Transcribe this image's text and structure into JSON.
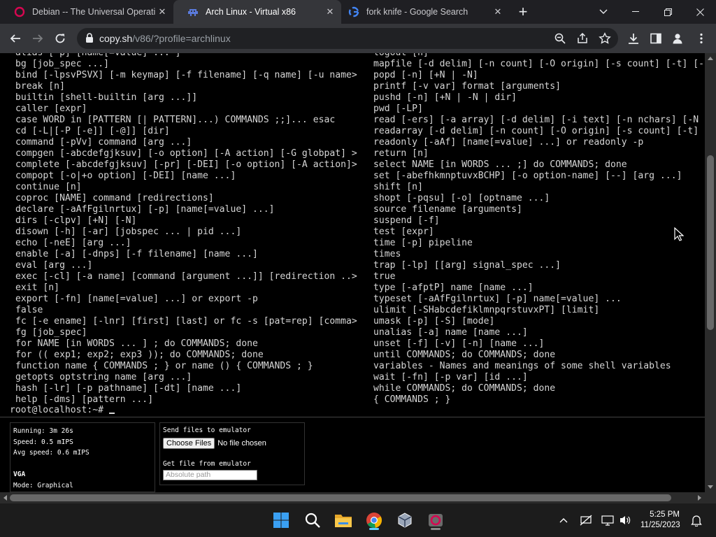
{
  "tabs": [
    {
      "title": "Debian -- The Universal Operati",
      "favicon": "debian-swirl-icon",
      "active": false
    },
    {
      "title": "Arch Linux - Virtual x86",
      "favicon": "space-invader-icon",
      "active": true
    },
    {
      "title": "fork knife - Google Search",
      "favicon": "google-g-icon",
      "active": false
    }
  ],
  "toolbar": {
    "url_host": "copy.sh",
    "url_path": "/v86/?profile=archlinux"
  },
  "terminal": {
    "left_column": [
      "alias [-p] [name[=value] ... ]",
      "bg [job_spec ...]",
      "bind [-lpsvPSVX] [-m keymap] [-f filename] [-q name] [-u name>",
      "break [n]",
      "builtin [shell-builtin [arg ...]]",
      "caller [expr]",
      "case WORD in [PATTERN [| PATTERN]...) COMMANDS ;;]... esac",
      "cd [-L|[-P [-e]] [-@]] [dir]",
      "command [-pVv] command [arg ...]",
      "compgen [-abcdefgjksuv] [-o option] [-A action] [-G globpat] >",
      "complete [-abcdefgjksuv] [-pr] [-DEI] [-o option] [-A action]>",
      "compopt [-o|+o option] [-DEI] [name ...]",
      "continue [n]",
      "coproc [NAME] command [redirections]",
      "declare [-aAfFgilnrtux] [-p] [name[=value] ...]",
      "dirs [-clpv] [+N] [-N]",
      "disown [-h] [-ar] [jobspec ... | pid ...]",
      "echo [-neE] [arg ...]",
      "enable [-a] [-dnps] [-f filename] [name ...]",
      "eval [arg ...]",
      "exec [-cl] [-a name] [command [argument ...]] [redirection ..>",
      "exit [n]",
      "export [-fn] [name[=value] ...] or export -p",
      "false",
      "fc [-e ename] [-lnr] [first] [last] or fc -s [pat=rep] [comma>",
      "fg [job_spec]",
      "for NAME [in WORDS ... ] ; do COMMANDS; done",
      "for (( exp1; exp2; exp3 )); do COMMANDS; done",
      "function name { COMMANDS ; } or name () { COMMANDS ; }",
      "getopts optstring name [arg ...]",
      "hash [-lr] [-p pathname] [-dt] [name ...]",
      "help [-dms] [pattern ...]"
    ],
    "right_column": [
      "logout [n]",
      "mapfile [-d delim] [-n count] [-O origin] [-s count] [-t] [-",
      "popd [-n] [+N | -N]",
      "printf [-v var] format [arguments]",
      "pushd [-n] [+N | -N | dir]",
      "pwd [-LP]",
      "read [-ers] [-a array] [-d delim] [-i text] [-n nchars] [-N",
      "readarray [-d delim] [-n count] [-O origin] [-s count] [-t]",
      "readonly [-aAf] [name[=value] ...] or readonly -p",
      "return [n]",
      "select NAME [in WORDS ... ;] do COMMANDS; done",
      "set [-abefhkmnptuvxBCHP] [-o option-name] [--] [arg ...]",
      "shift [n]",
      "shopt [-pqsu] [-o] [optname ...]",
      "source filename [arguments]",
      "suspend [-f]",
      "test [expr]",
      "time [-p] pipeline",
      "times",
      "trap [-lp] [[arg] signal_spec ...]",
      "true",
      "type [-afptP] name [name ...]",
      "typeset [-aAfFgilnrtux] [-p] name[=value] ...",
      "ulimit [-SHabcdefiklmnpqrstuvxPT] [limit]",
      "umask [-p] [-S] [mode]",
      "unalias [-a] name [name ...]",
      "unset [-f] [-v] [-n] [name ...]",
      "until COMMANDS; do COMMANDS; done",
      "variables - Names and meanings of some shell variables",
      "wait [-fn] [-p var] [id ...]",
      "while COMMANDS; do COMMANDS; done",
      "{ COMMANDS ; }"
    ],
    "prompt": "root@localhost:~# "
  },
  "status": {
    "running": "Running: 3m 26s",
    "speed": "Speed: 0.5 mIPS",
    "avg_speed": "Avg speed: 0.6 mIPS",
    "vga": "VGA",
    "mode": "Mode: Graphical"
  },
  "files": {
    "send_label": "Send files to emulator",
    "choose_button": "Choose Files",
    "no_file": "No file chosen",
    "get_label": "Get file from emulator",
    "path_placeholder": "Absolute path"
  },
  "clock": {
    "time": "5:25 PM",
    "date": "11/25/2023"
  },
  "colors": {
    "tab_strip": "#1f1f23",
    "active_tab": "#35363a",
    "terminal_text": "#d6d6d6",
    "terminal_bg": "#000000"
  }
}
